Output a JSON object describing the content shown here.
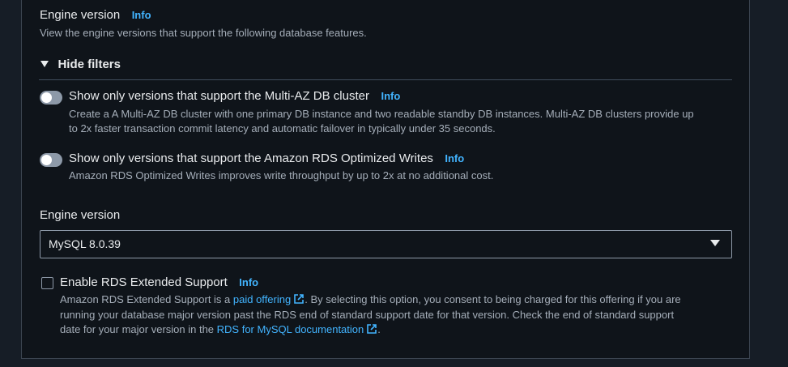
{
  "engine_section": {
    "title": "Engine version",
    "info": "Info",
    "description": "View the engine versions that support the following database features."
  },
  "filters": {
    "toggle_label": "Hide filters",
    "multi_az": {
      "label": "Show only versions that support the Multi-AZ DB cluster",
      "info": "Info",
      "description_line1": "Create a A Multi-AZ DB cluster with one primary DB instance and two readable standby DB instances. Multi-AZ DB clusters provide up",
      "description_line2": "to 2x faster transaction commit latency and automatic failover in typically under 35 seconds.",
      "enabled": false
    },
    "optimized_writes": {
      "label": "Show only versions that support the Amazon RDS Optimized Writes",
      "info": "Info",
      "description": "Amazon RDS Optimized Writes improves write throughput by up to 2x at no additional cost.",
      "enabled": false
    }
  },
  "engine_select": {
    "label": "Engine version",
    "value": "MySQL 8.0.39"
  },
  "extended_support": {
    "label": "Enable RDS Extended Support",
    "info": "Info",
    "checked": false,
    "line1_before": "Amazon RDS Extended Support is a ",
    "line1_link": "paid offering",
    "line1_after": ". By selecting this option, you consent to being charged for this offering if you are",
    "line2": "running your database major version past the RDS end of standard support date for that version. Check the end of standard support",
    "line3_before": "date for your major version in the ",
    "line3_link": "RDS for MySQL documentation",
    "line3_after": "."
  },
  "colors": {
    "background": "#0f141a",
    "link": "#42b4ff",
    "border": "#8d99a8"
  },
  "icons": [
    "caret-down-icon",
    "toggle-switch",
    "external-link-icon",
    "dropdown-caret-icon"
  ]
}
